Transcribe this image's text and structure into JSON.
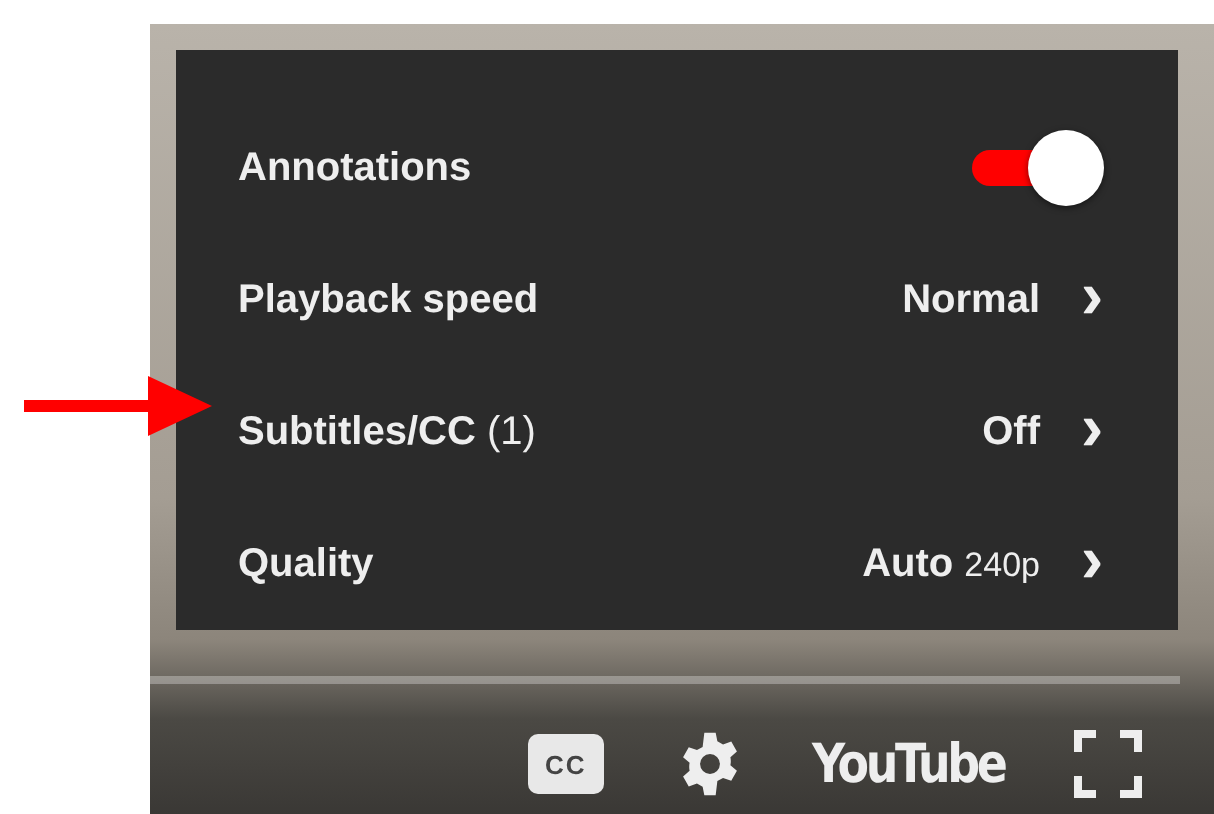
{
  "menu": {
    "items": [
      {
        "kind": "toggle",
        "label": "Annotations",
        "on": true
      },
      {
        "kind": "submenu",
        "label": "Playback speed",
        "value": "Normal",
        "chevron": "›"
      },
      {
        "kind": "submenu",
        "label": "Subtitles/CC",
        "count": "(1)",
        "value": "Off",
        "chevron": "›"
      },
      {
        "kind": "submenu",
        "label": "Quality",
        "value": "Auto",
        "detail": "240p",
        "chevron": "›"
      }
    ]
  },
  "controls": {
    "cc_label": "CC",
    "logo": "YouTube"
  }
}
